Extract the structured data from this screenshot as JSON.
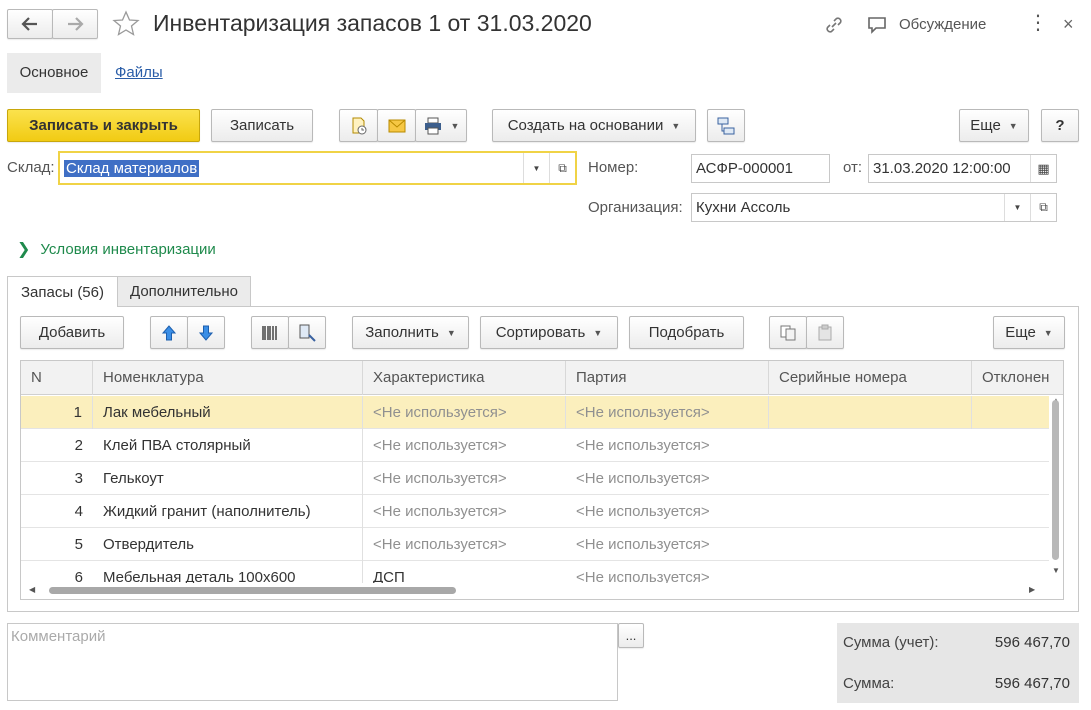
{
  "window": {
    "title": "Инвентаризация запасов 1 от 31.03.2020",
    "discussion_label": "Обсуждение"
  },
  "tabs_top": [
    {
      "label": "Основное"
    },
    {
      "label": "Файлы"
    }
  ],
  "toolbar": {
    "save_close": "Записать и закрыть",
    "save": "Записать",
    "create_based": "Создать на основании",
    "more": "Еще",
    "help": "?"
  },
  "form": {
    "warehouse_label": "Склад:",
    "warehouse_value": "Склад материалов",
    "number_label": "Номер:",
    "number_value": "АСФР-000001",
    "date_label": "от:",
    "date_value": "31.03.2020 12:00:00",
    "org_label": "Организация:",
    "org_value": "Кухни Ассоль",
    "conditions_link": "Условия инвентаризации"
  },
  "subtabs": [
    {
      "label": "Запасы (56)"
    },
    {
      "label": "Дополнительно"
    }
  ],
  "table_toolbar": {
    "add": "Добавить",
    "fill": "Заполнить",
    "sort": "Сортировать",
    "pick": "Подобрать",
    "more": "Еще"
  },
  "table": {
    "columns": [
      "N",
      "Номенклатура",
      "Характеристика",
      "Партия",
      "Серийные номера",
      "Отклонен"
    ],
    "rows": [
      {
        "n": "1",
        "name": "Лак мебельный",
        "char": "<Не используется>",
        "batch": "<Не используется>",
        "serial": ""
      },
      {
        "n": "2",
        "name": "Клей ПВА столярный",
        "char": "<Не используется>",
        "batch": "<Не используется>",
        "serial": ""
      },
      {
        "n": "3",
        "name": "Гелькоут",
        "char": "<Не используется>",
        "batch": "<Не используется>",
        "serial": ""
      },
      {
        "n": "4",
        "name": "Жидкий гранит (наполнитель)",
        "char": "<Не используется>",
        "batch": "<Не используется>",
        "serial": ""
      },
      {
        "n": "5",
        "name": "Отвердитель",
        "char": "<Не используется>",
        "batch": "<Не используется>",
        "serial": ""
      },
      {
        "n": "6",
        "name": "Мебельная деталь 100х600",
        "char": "ДСП",
        "batch": "<Не используется>",
        "serial": ""
      }
    ]
  },
  "footer": {
    "comment_placeholder": "Комментарий",
    "ellipsis": "...",
    "sum_account_label": "Сумма (учет):",
    "sum_account_value": "596 467,70",
    "sum_label": "Сумма:",
    "sum_value": "596 467,70"
  },
  "colors": {
    "primary_yellow": "#f5d41f",
    "link_green": "#1f8a4c",
    "selected_row": "#fbefbd",
    "link_blue": "#2a5da8"
  }
}
